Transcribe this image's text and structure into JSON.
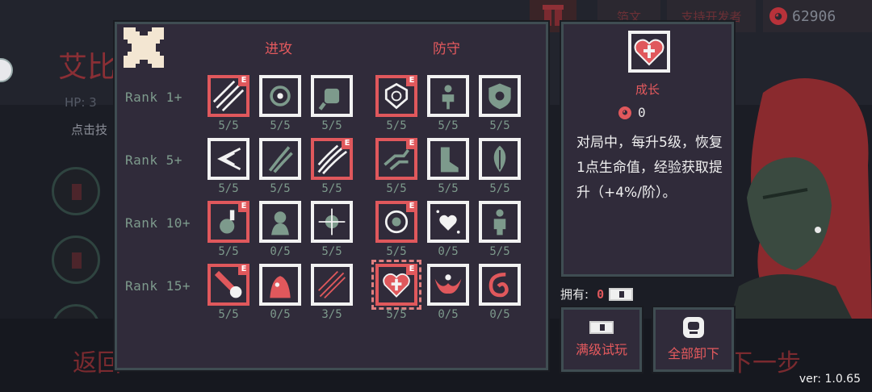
{
  "background": {
    "character_name": "艾比",
    "hp_label": "HP: 3",
    "hint": "点击技",
    "back_label": "返回",
    "next_label": "下一步",
    "top_btn_1": "箔文",
    "top_btn_2": "支持开发者",
    "coins": "62906"
  },
  "panel": {
    "columns": {
      "attack": "进攻",
      "defense": "防守"
    },
    "ranks": [
      {
        "label": "Rank 1+",
        "slots": [
          {
            "icon": "slash-icon",
            "count": "5/5",
            "equipped": true
          },
          {
            "icon": "vortex-icon",
            "count": "5/5",
            "equipped": false
          },
          {
            "icon": "fist-icon",
            "count": "5/5",
            "equipped": false
          },
          {
            "icon": "shield-burst-icon",
            "count": "5/5",
            "equipped": true
          },
          {
            "icon": "strength-icon",
            "count": "5/5",
            "equipped": false
          },
          {
            "icon": "guard-shield-icon",
            "count": "5/5",
            "equipped": false
          }
        ]
      },
      {
        "label": "Rank 5+",
        "slots": [
          {
            "icon": "arrow-burst-icon",
            "count": "5/5",
            "equipped": false
          },
          {
            "icon": "claw-icon",
            "count": "5/5",
            "equipped": false
          },
          {
            "icon": "wave-icon",
            "count": "5/5",
            "equipped": true
          },
          {
            "icon": "dash-icon",
            "count": "5/5",
            "equipped": true
          },
          {
            "icon": "boot-icon",
            "count": "5/5",
            "equipped": false
          },
          {
            "icon": "leaf-icon",
            "count": "5/5",
            "equipped": false
          }
        ]
      },
      {
        "label": "Rank 10+",
        "slots": [
          {
            "icon": "potion-icon",
            "count": "5/5",
            "equipped": true
          },
          {
            "icon": "beast-icon",
            "count": "0/5",
            "equipped": false
          },
          {
            "icon": "spark-icon",
            "count": "5/5",
            "equipped": false
          },
          {
            "icon": "orb-icon",
            "count": "5/5",
            "equipped": true
          },
          {
            "icon": "heart-stars-icon",
            "count": "0/5",
            "equipped": false
          },
          {
            "icon": "figure-icon",
            "count": "5/5",
            "equipped": false
          }
        ]
      },
      {
        "label": "Rank 15+",
        "slots": [
          {
            "icon": "comet-icon",
            "count": "5/5",
            "equipped": true
          },
          {
            "icon": "demon-icon",
            "count": "0/5",
            "equipped": false
          },
          {
            "icon": "arrows-icon",
            "count": "3/5",
            "equipped": false
          },
          {
            "icon": "heart-cross-icon",
            "count": "5/5",
            "equipped": true,
            "selected": true
          },
          {
            "icon": "angel-icon",
            "count": "0/5",
            "equipped": false
          },
          {
            "icon": "swirl-icon",
            "count": "0/5",
            "equipped": false
          }
        ]
      }
    ],
    "equipped_tag": "E"
  },
  "detail": {
    "name": "成长",
    "cost": "0",
    "description": "对局中，每升5级，恢复1点生命值，经验获取提升（+4%/阶）。"
  },
  "owned": {
    "label": "拥有:",
    "count": "0"
  },
  "buttons": {
    "trial": "满级试玩",
    "unequip_all": "全部卸下"
  },
  "version": "ver: 1.0.65",
  "colors": {
    "accent": "#e0585c",
    "panel": "#302b3a",
    "muted_green": "#7d9a8c"
  }
}
